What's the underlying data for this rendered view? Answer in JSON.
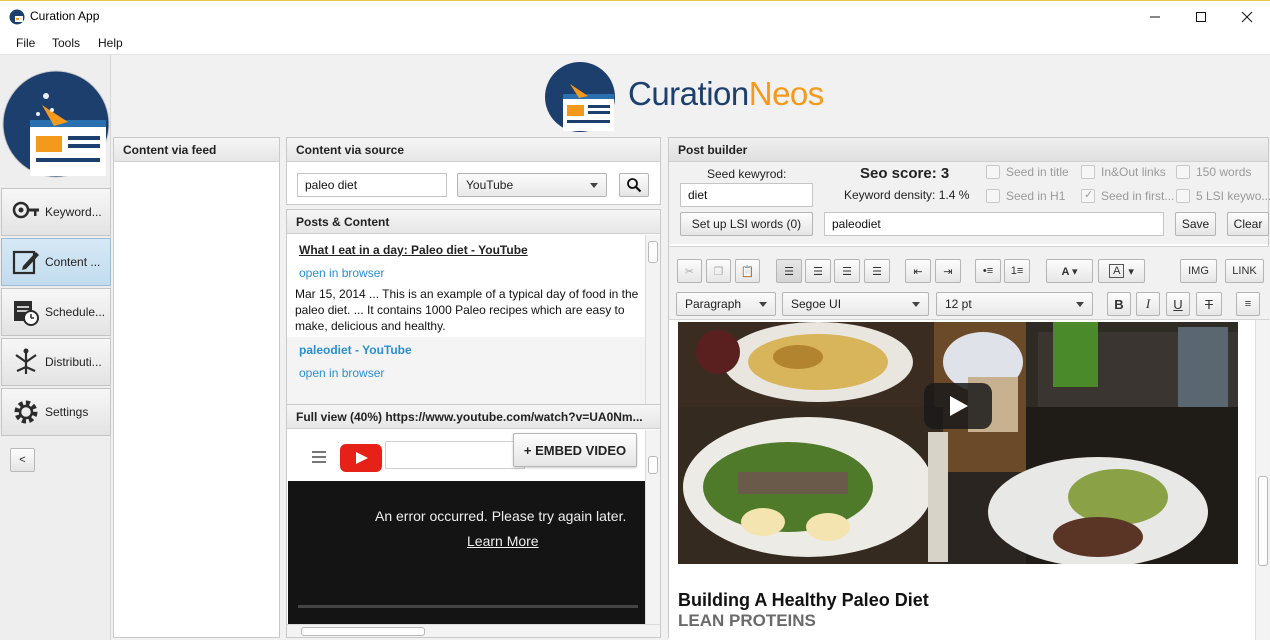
{
  "window": {
    "title": "Curation App"
  },
  "menu": [
    "File",
    "Tools",
    "Help"
  ],
  "brand": {
    "part1": "Curation",
    "part2": "Neos",
    "color1": "#1d3f6e",
    "color2": "#f39a1c"
  },
  "sidebar": {
    "items": [
      {
        "label": "Keyword...",
        "icon": "keyword-icon"
      },
      {
        "label": "Content ...",
        "icon": "content-edit-icon",
        "active": true
      },
      {
        "label": "Schedule...",
        "icon": "schedule-icon"
      },
      {
        "label": "Distributi...",
        "icon": "distribution-icon"
      },
      {
        "label": "Settings",
        "icon": "gear-icon"
      }
    ],
    "collapse_label": "<"
  },
  "feed_panel": {
    "title": "Content via feed"
  },
  "source_panel": {
    "title": "Content via source",
    "search_value": "paleo diet",
    "source_selected": "YouTube"
  },
  "posts_panel": {
    "title": "Posts & Content",
    "items": [
      {
        "title": "What I eat in a day: Paleo diet - YouTube",
        "link": "open in browser",
        "description": "Mar 15, 2014 ... This is an example of a typical day of food in the paleo diet. ... It contains 1000 Paleo recipes which are easy to make, delicious and healthy."
      },
      {
        "title": "paleodiet - YouTube",
        "link": "open in browser"
      }
    ]
  },
  "full_view": {
    "title": "Full view (40%) https://www.youtube.com/watch?v=UA0Nm...",
    "embed_label": "+ EMBED VIDEO",
    "error_text": "An error occurred. Please try again later.",
    "learn_more": "Learn More"
  },
  "post_builder": {
    "title": "Post builder",
    "seed_keyword_label": "Seed kewyrod:",
    "seed_keyword_value": "diet",
    "seo_score_label": "Seo score: 3",
    "keyword_density_label": "Keyword density: 1.4 %",
    "checks": [
      {
        "label": "Seed in title",
        "checked": false
      },
      {
        "label": "In&Out links",
        "checked": false
      },
      {
        "label": "150 words",
        "checked": false
      },
      {
        "label": "Seed in H1",
        "checked": false
      },
      {
        "label": "Seed in first...",
        "checked": true
      },
      {
        "label": "5 LSI keywo...",
        "checked": false
      }
    ],
    "lsi_button": "Set up LSI words (0)",
    "lsi_value": "paleodiet",
    "save_label": "Save",
    "clear_label": "Clear",
    "toolbar": {
      "img_label": "IMG",
      "link_label": "LINK",
      "paragraph": "Paragraph",
      "font": "Segoe UI",
      "size": "12 pt"
    },
    "article_title": "Building A Healthy Paleo Diet",
    "article_subtitle": "LEAN PROTEINS"
  }
}
